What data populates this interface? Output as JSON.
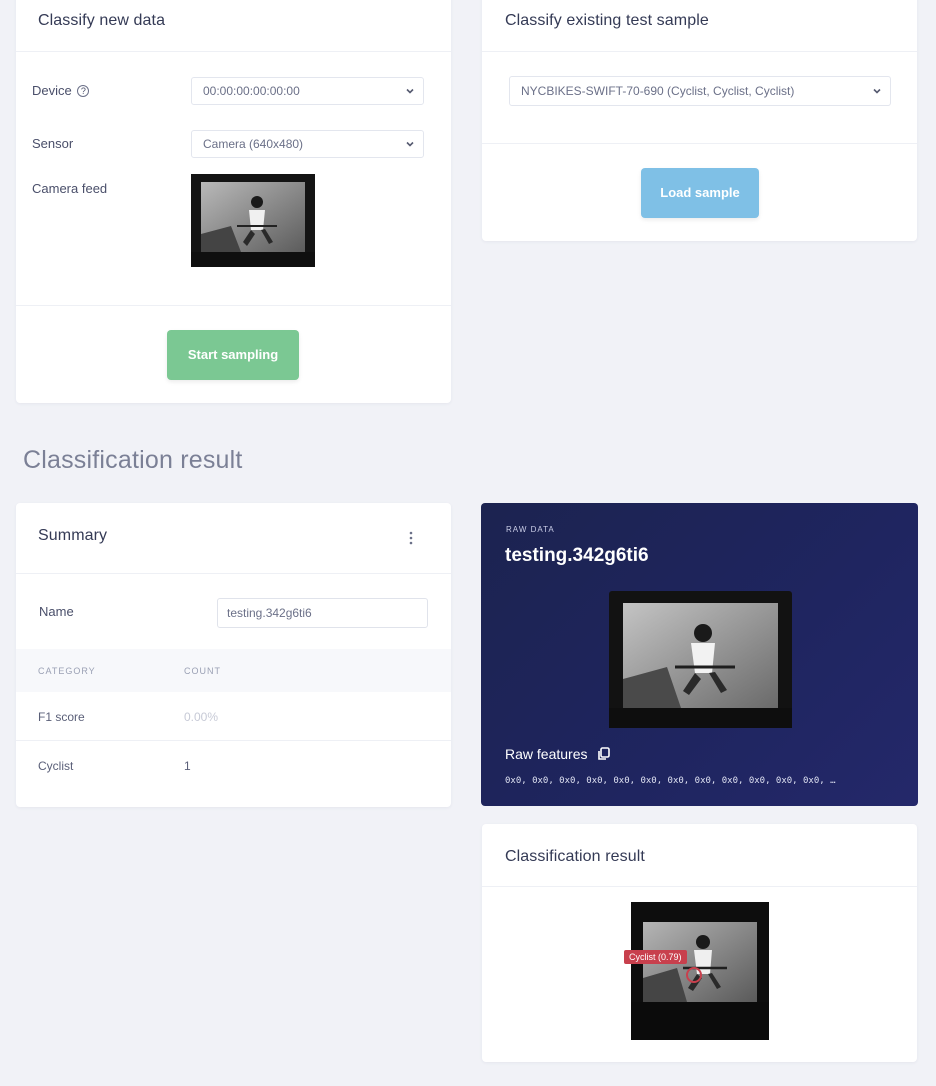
{
  "new_data": {
    "title": "Classify new data",
    "device_label": "Device",
    "device_value": "00:00:00:00:00:00",
    "sensor_label": "Sensor",
    "sensor_value": "Camera (640x480)",
    "feed_label": "Camera feed",
    "start_button": "Start sampling"
  },
  "existing": {
    "title": "Classify existing test sample",
    "sample_value": "NYCBIKES-SWIFT-70-690 (Cyclist, Cyclist, Cyclist)",
    "load_button": "Load sample"
  },
  "section_heading": "Classification result",
  "summary": {
    "title": "Summary",
    "name_label": "Name",
    "name_value": "testing.342g6ti6",
    "columns": [
      "CATEGORY",
      "COUNT"
    ],
    "rows": [
      {
        "category": "F1 score",
        "count": "0.00%"
      },
      {
        "category": "Cyclist",
        "count": "1"
      }
    ]
  },
  "raw_data": {
    "eyebrow": "RAW DATA",
    "title": "testing.342g6ti6",
    "features_label": "Raw features",
    "features_value": "0x0, 0x0, 0x0, 0x0, 0x0, 0x0, 0x0, 0x0, 0x0, 0x0, 0x0, 0x0, …"
  },
  "result_card": {
    "title": "Classification result",
    "detection_label": "Cyclist (0.79)"
  },
  "colors": {
    "start_button": "#7bc893",
    "load_button": "#7fc0e6",
    "raw_bg": "#1f2560",
    "detection": "#c8404d"
  }
}
